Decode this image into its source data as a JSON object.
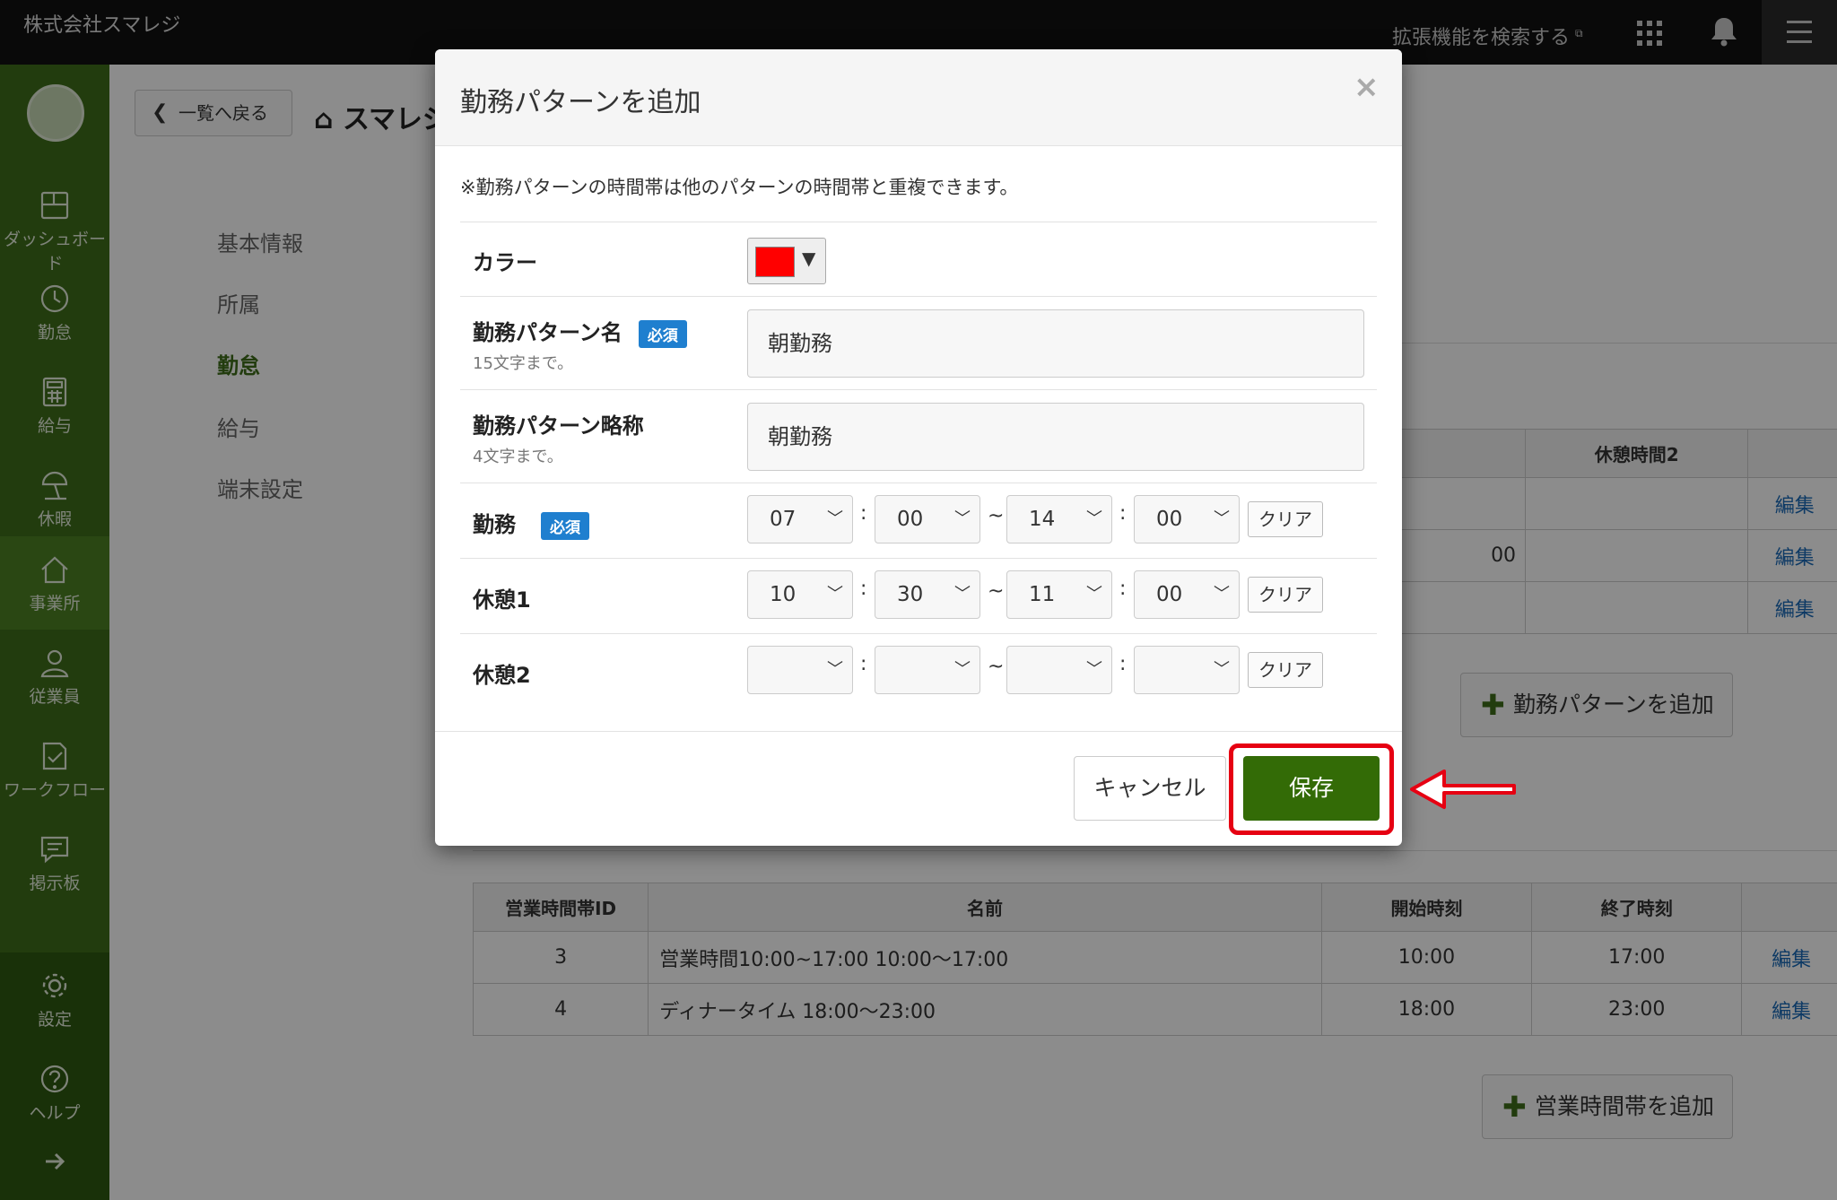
{
  "topbar": {
    "company": "株式会社スマレジ",
    "ext_search": "拡張機能を検索する"
  },
  "sidebar": {
    "items": [
      {
        "label": "ダッシュボード",
        "icon": "dashboard-icon"
      },
      {
        "label": "勤怠",
        "icon": "clock-icon"
      },
      {
        "label": "給与",
        "icon": "calculator-icon"
      },
      {
        "label": "休暇",
        "icon": "beach-umbrella-icon"
      },
      {
        "label": "事業所",
        "icon": "home-icon"
      },
      {
        "label": "従業員",
        "icon": "person-icon"
      },
      {
        "label": "ワークフロー",
        "icon": "checklist-icon"
      },
      {
        "label": "掲示板",
        "icon": "chat-icon"
      },
      {
        "label": "設定",
        "icon": "gear-icon"
      },
      {
        "label": "ヘルプ",
        "icon": "help-icon"
      }
    ]
  },
  "page": {
    "back_label": "一覧へ戻る",
    "title": "スマレジ",
    "subnav": [
      "基本情報",
      "所属",
      "勤怠",
      "給与",
      "端末設定"
    ],
    "pattern_table": {
      "header_break2": "休憩時間2",
      "row2_partial": "00",
      "edit_label": "編集"
    },
    "add_pattern_label": "勤務パターンを追加",
    "hours_table": {
      "headers": [
        "営業時間帯ID",
        "名前",
        "開始時刻",
        "終了時刻",
        ""
      ],
      "rows": [
        {
          "id": "3",
          "name": "営業時間10:00~17:00 10:00〜17:00",
          "start": "10:00",
          "end": "17:00",
          "edit": "編集"
        },
        {
          "id": "4",
          "name": "ディナータイム 18:00〜23:00",
          "start": "18:00",
          "end": "23:00",
          "edit": "編集"
        }
      ]
    },
    "add_hours_label": "営業時間帯を追加"
  },
  "modal": {
    "title": "勤務パターンを追加",
    "close": "×",
    "note": "※勤務パターンの時間帯は他のパターンの時間帯と重複できます。",
    "color_label": "カラー",
    "color_value": "#ff0000",
    "name_label": "勤務パターン名",
    "name_hint": "15文字まで。",
    "name_value": "朝勤務",
    "short_label": "勤務パターン略称",
    "short_hint": "4文字まで。",
    "short_value": "朝勤務",
    "required": "必須",
    "work_label": "勤務",
    "break1_label": "休憩1",
    "break2_label": "休憩2",
    "work_times": [
      "07",
      "00",
      "14",
      "00"
    ],
    "break1_times": [
      "10",
      "30",
      "11",
      "00"
    ],
    "break2_times": [
      "",
      "",
      "",
      ""
    ],
    "clear_label": "クリア",
    "cancel_label": "キャンセル",
    "save_label": "保存"
  },
  "colors": {
    "brand_green": "#3e6e1a",
    "save_green": "#336b06",
    "required_blue": "#1f7fcf",
    "annotation_red": "#e60012"
  }
}
